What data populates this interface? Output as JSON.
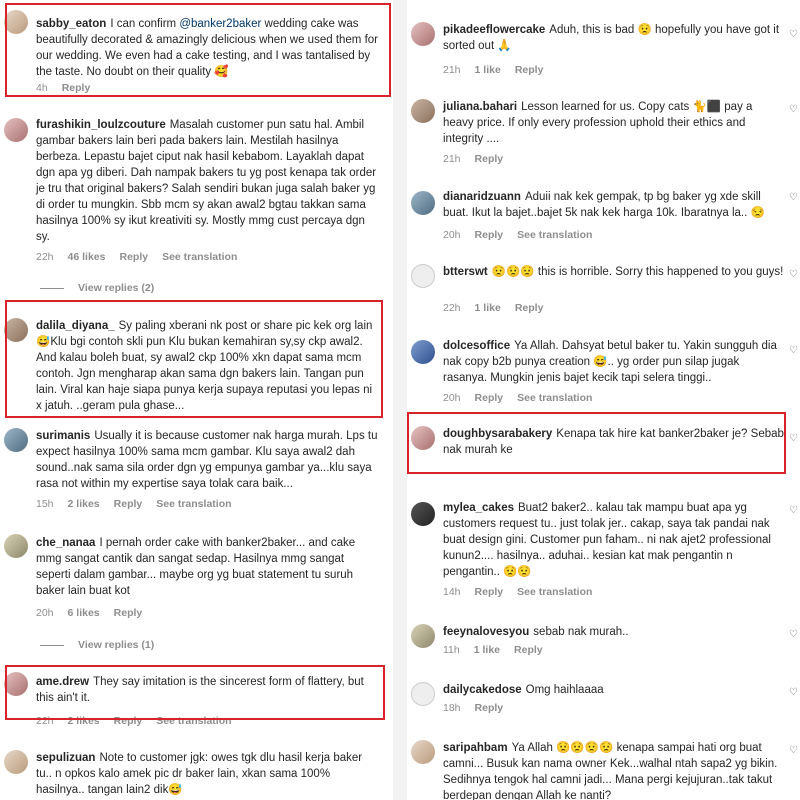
{
  "colors": {
    "highlight": "#d8232a",
    "meta": "#8e8e8e",
    "mention": "#00376b"
  },
  "left": [
    {
      "user": "sabby_eaton",
      "pre": "I can confirm ",
      "mention": "@banker2baker",
      "text": " wedding cake was beautifully decorated & amazingly delicious when we used them for our wedding. We even had a cake testing, and I was tantalised by the taste. No doubt on their quality 🥰",
      "time": "4h",
      "reply": "Reply"
    },
    {
      "user": "furashikin_loulzcouture",
      "text": "Masalah customer pun satu hal. Ambil gambar bakers lain beri pada bakers lain. Mestilah hasilnya berbeza. Lepastu bajet ciput nak hasil kebabom. Layaklah dapat dgn apa yg diberi. Dah nampak bakers tu yg post kenapa tak order je tru that original bakers? Salah sendiri bukan juga salah baker yg di order tu mungkin. Sbb mcm sy akan awal2 bgtau takkan sama hasilnya 100% sy ikut kreativiti sy. Mostly mmg cust percaya dgn sy.",
      "time": "22h",
      "likes": "46 likes",
      "reply": "Reply",
      "translate": "See translation",
      "view_replies": "View replies (2)"
    },
    {
      "user": "dalila_diyana_",
      "text": "Sy paling xberani nk post or share pic kek org lain😅Klu bgi contoh skli pun Klu bukan kemahiran sy,sy ckp awal2. And kalau boleh buat, sy awal2 ckp 100% xkn dapat sama mcm contoh. Jgn mengharap akan sama dgn bakers lain. Tangan pun lain. Viral kan haje siapa punya kerja supaya reputasi you lepas ni x jatuh. ..geram pula ghase..."
    },
    {
      "user": "surimanis",
      "text": "Usually it is because customer nak harga murah. Lps tu expect hasilnya 100% sama mcm gambar. Klu saya awal2 dah sound..nak sama sila order dgn yg empunya gambar ya...klu saya rasa not within my expertise saya tolak cara baik...",
      "time": "15h",
      "likes": "2 likes",
      "reply": "Reply",
      "translate": "See translation"
    },
    {
      "user": "che_nanaa",
      "text": "I pernah order cake with banker2baker... and cake mmg sangat cantik dan sangat sedap. Hasilnya mmg sangat seperti dalam gambar... maybe org yg buat statement tu suruh baker lain buat kot",
      "time": "20h",
      "likes": "6 likes",
      "reply": "Reply",
      "view_replies": "View replies (1)"
    },
    {
      "user": "ame.drew",
      "text": "They say imitation is the sincerest form of flattery, but this ain't it.",
      "time": "22h",
      "likes": "2 likes",
      "reply": "Reply",
      "translate": "See translation"
    },
    {
      "user": "sepulizuan",
      "text": "Note to customer jgk: owes tgk dlu hasil kerja baker tu.. n opkos kalo amek pic dr baker lain, xkan sama 100% hasilnya.. tangan lain2 dik😅"
    }
  ],
  "right": [
    {
      "user": "pikadeeflowercake",
      "text": "Aduh, this is bad 😟 hopefully you have got it sorted out 🙏",
      "time": "21h",
      "likes": "1 like",
      "reply": "Reply"
    },
    {
      "user": "juliana.bahari",
      "text": "Lesson learned for us. Copy cats 🐈⬛ pay a heavy price. If only every profession uphold their ethics and integrity ....",
      "time": "21h",
      "reply": "Reply"
    },
    {
      "user": "dianaridzuann",
      "text": "Aduii nak kek gempak, tp bg baker yg xde skill buat. Ikut la bajet..bajet 5k nak kek harga 10k. Ibaratnya la.. 😒",
      "time": "20h",
      "reply": "Reply",
      "translate": "See translation"
    },
    {
      "user": "btterswt",
      "text": "😟😟😟 this is horrible. Sorry this happened to you guys!",
      "time": "22h",
      "likes": "1 like",
      "reply": "Reply"
    },
    {
      "user": "dolcesoffice",
      "text": "Ya Allah. Dahsyat betul baker tu. Yakin sungguh dia nak copy b2b punya creation 😅.. yg order pun silap jugak rasanya. Mungkin jenis bajet kecik tapi selera tinggi..",
      "time": "20h",
      "reply": "Reply",
      "translate": "See translation"
    },
    {
      "user": "doughbysarabakery",
      "text": "Kenapa tak hire kat banker2baker je? Sebab nak murah ke"
    },
    {
      "user": "mylea_cakes",
      "text": "Buat2 baker2.. kalau tak mampu buat apa yg customers request tu.. just tolak jer.. cakap, saya tak pandai nak buat design gini. Customer pun faham.. ni nak ajet2 professional kunun2.... hasilnya.. aduhai.. kesian kat mak pengantin n pengantin.. 😟😟",
      "time": "14h",
      "reply": "Reply",
      "translate": "See translation"
    },
    {
      "user": "feeynalovesyou",
      "text": "sebab nak murah..",
      "time": "11h",
      "likes": "1 like",
      "reply": "Reply"
    },
    {
      "user": "dailycakedose",
      "text": "Omg haihlaaaa",
      "time": "18h",
      "reply": "Reply"
    },
    {
      "user": "saripahbam",
      "text": "Ya Allah 😟😟😟😟 kenapa sampai hati org buat camni... Busuk kan nama owner Kek...walhal ntah sapa2 yg bikin. Sedihnya tengok hal camni jadi... Mana pergi kejujuran..tak takut berdepan dengan Allah ke nanti?"
    }
  ]
}
